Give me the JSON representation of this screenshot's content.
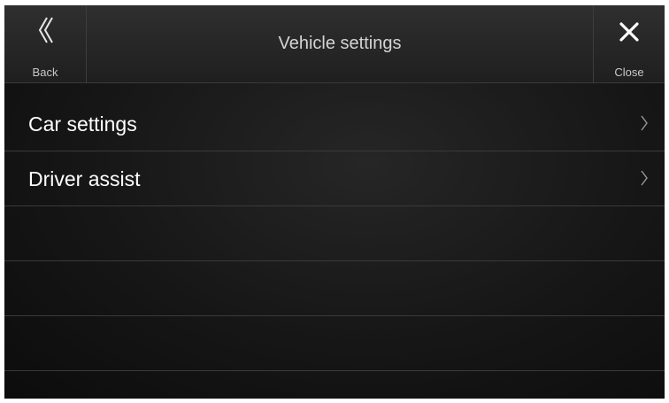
{
  "header": {
    "title": "Vehicle settings",
    "back_label": "Back",
    "back_icon": "double-chevron-left-icon",
    "close_label": "Close",
    "close_icon": "close-icon"
  },
  "menu": {
    "items": [
      {
        "label": "Car settings",
        "icon": "chevron-right-icon"
      },
      {
        "label": "Driver assist",
        "icon": "chevron-right-icon"
      }
    ],
    "empty_rows": 3
  },
  "colors": {
    "background": "#161616",
    "header": "#2a2a2a",
    "divider": "#3a3a3a",
    "text": "#ffffff",
    "secondary_text": "#c8c8c8"
  }
}
